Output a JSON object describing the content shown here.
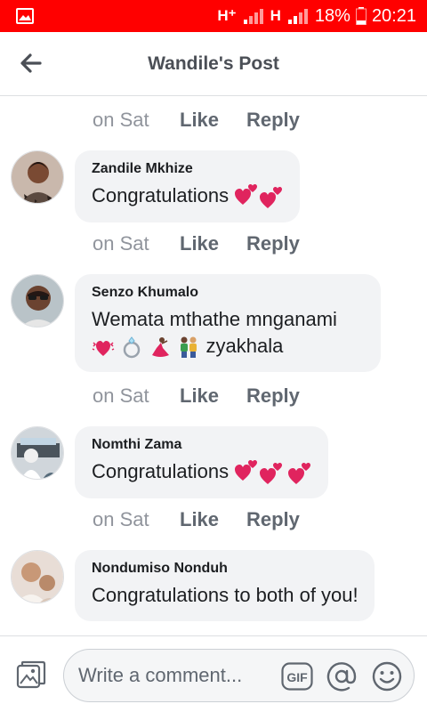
{
  "status_bar": {
    "network_1": "H⁺",
    "network_2": "H",
    "battery": "18%",
    "time": "20:21",
    "background_color": "#ff0000"
  },
  "header": {
    "title": "Wandile's Post",
    "back_icon": "arrow-left-icon"
  },
  "comments": {
    "top_meta": {
      "time": "on Sat",
      "like": "Like",
      "reply": "Reply"
    },
    "items": [
      {
        "author": "Zandile Mkhize",
        "text": "Congratulations",
        "emojis": [
          "two-hearts-icon",
          "two-hearts-icon"
        ],
        "meta": {
          "time": "on Sat",
          "like": "Like",
          "reply": "Reply"
        }
      },
      {
        "author": "Senzo Khumalo",
        "text": "Wemata mthathe mnganami",
        "text_2": "zyakhala",
        "emojis": [
          "vibrating-heart-icon",
          "ring-icon",
          "dancer-icon",
          "couple-icon"
        ],
        "meta": {
          "time": "on Sat",
          "like": "Like",
          "reply": "Reply"
        }
      },
      {
        "author": "Nomthi Zama",
        "text": "Congratulations",
        "emojis": [
          "two-hearts-icon",
          "two-hearts-icon",
          "two-hearts-icon"
        ],
        "meta": {
          "time": "on Sat",
          "like": "Like",
          "reply": "Reply"
        }
      },
      {
        "author": "Nondumiso Nonduh",
        "text": "Congratulations to both of you!"
      }
    ]
  },
  "composer": {
    "placeholder": "Write a comment...",
    "gif_label": "GIF",
    "icons": [
      "photo-icon",
      "gif-icon",
      "mention-at-icon",
      "emoji-smile-icon"
    ]
  },
  "colors": {
    "bubble": "#f2f3f5",
    "meta_text": "#90949c",
    "action_text": "#606770",
    "heart": "#e0245e"
  }
}
